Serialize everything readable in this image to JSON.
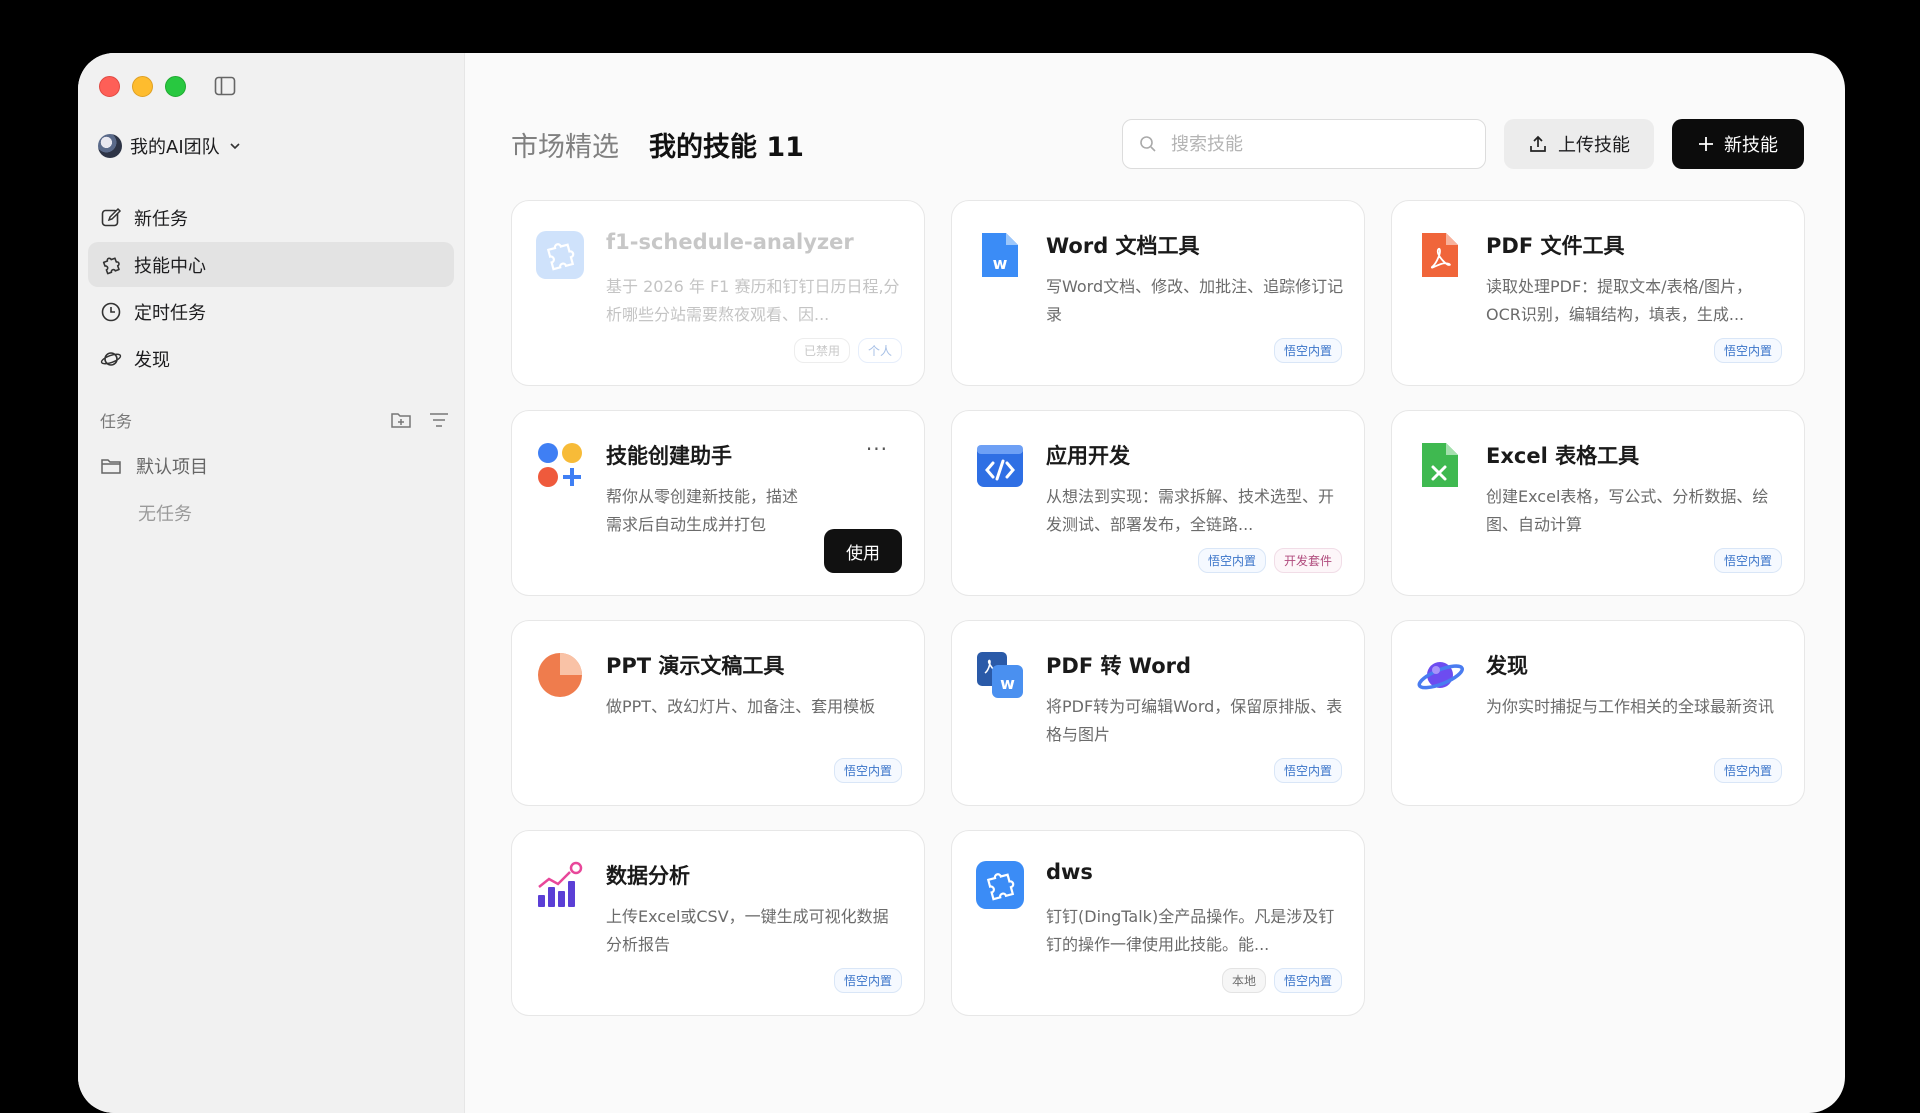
{
  "sidebar": {
    "team_name": "我的AI团队",
    "nav": [
      {
        "label": "新任务",
        "icon": "edit-icon"
      },
      {
        "label": "技能中心",
        "icon": "puzzle-icon"
      },
      {
        "label": "定时任务",
        "icon": "clock-icon"
      },
      {
        "label": "发现",
        "icon": "planet-icon"
      }
    ],
    "section_title": "任务",
    "project": "默认项目",
    "empty": "无任务"
  },
  "header": {
    "tab_market": "市场精选",
    "tab_mine": "我的技能 11",
    "search_placeholder": "搜索技能",
    "upload_label": "上传技能",
    "new_label": "新技能"
  },
  "cards": [
    {
      "title": "f1-schedule-analyzer",
      "desc": "基于 2026 年 F1 赛历和钉钉日历日程,分析哪些分站需要熬夜观看、因...",
      "tags": [
        "已禁用",
        "个人"
      ]
    },
    {
      "title": "Word 文档工具",
      "desc": "写Word文档、修改、加批注、追踪修订记录",
      "tags": [
        "悟空内置"
      ]
    },
    {
      "title": "PDF 文件工具",
      "desc": "读取处理PDF：提取文本/表格/图片，OCR识别，编辑结构，填表，生成...",
      "tags": [
        "悟空内置"
      ]
    },
    {
      "title": "技能创建助手",
      "desc": "帮你从零创建新技能，描述需求后自动生成并打包",
      "more": "···",
      "use": "使用"
    },
    {
      "title": "应用开发",
      "desc": "从想法到实现：需求拆解、技术选型、开发测试、部署发布，全链路...",
      "tags": [
        "悟空内置",
        "开发套件"
      ]
    },
    {
      "title": "Excel 表格工具",
      "desc": "创建Excel表格，写公式、分析数据、绘图、自动计算",
      "tags": [
        "悟空内置"
      ]
    },
    {
      "title": "PPT 演示文稿工具",
      "desc": "做PPT、改幻灯片、加备注、套用模板",
      "tags": [
        "悟空内置"
      ]
    },
    {
      "title": "PDF 转 Word",
      "desc": "将PDF转为可编辑Word，保留原排版、表格与图片",
      "tags": [
        "悟空内置"
      ]
    },
    {
      "title": "发现",
      "desc": "为你实时捕捉与工作相关的全球最新资讯",
      "tags": [
        "悟空内置"
      ]
    },
    {
      "title": "数据分析",
      "desc": "上传Excel或CSV，一键生成可视化数据分析报告",
      "tags": [
        "悟空内置"
      ]
    },
    {
      "title": "dws",
      "desc": "钉钉(DingTalk)全产品操作。凡是涉及钉钉的操作一律使用此技能。能...",
      "tags": [
        "本地",
        "悟空内置"
      ]
    }
  ]
}
